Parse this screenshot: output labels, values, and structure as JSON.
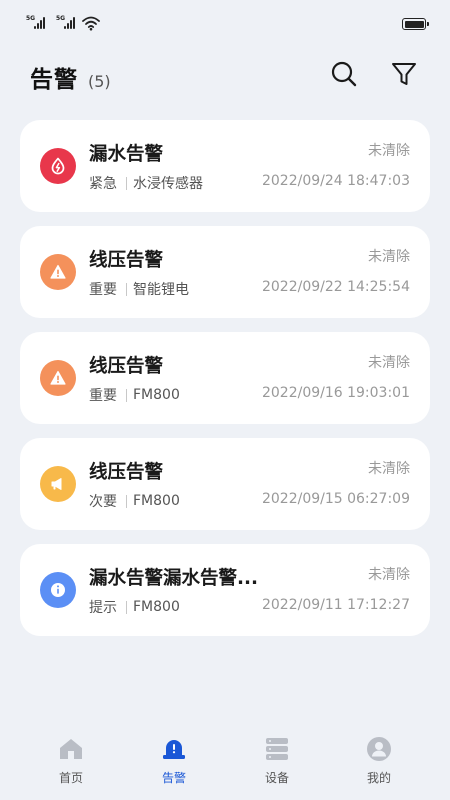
{
  "status_bar": {
    "signal1": "5G",
    "signal2": "5G"
  },
  "header": {
    "title": "告警",
    "count": "(5)"
  },
  "icons": {
    "search": "search-icon",
    "filter": "filter-icon"
  },
  "alarms": [
    {
      "title": "漏水告警",
      "level": "紧急",
      "source": "水浸传感器",
      "status": "未清除",
      "time": "2022/09/24 18:47:03",
      "color": "#e8374b",
      "icon": "water-leak-icon"
    },
    {
      "title": "线压告警",
      "level": "重要",
      "source": "智能锂电",
      "status": "未清除",
      "time": "2022/09/22 14:25:54",
      "color": "#f4915b",
      "icon": "warning-triangle-icon"
    },
    {
      "title": "线压告警",
      "level": "重要",
      "source": "FM800",
      "status": "未清除",
      "time": "2022/09/16 19:03:01",
      "color": "#f4915b",
      "icon": "warning-triangle-icon"
    },
    {
      "title": "线压告警",
      "level": "次要",
      "source": "FM800",
      "status": "未清除",
      "time": "2022/09/15 06:27:09",
      "color": "#f8b94a",
      "icon": "megaphone-icon"
    },
    {
      "title": "漏水告警漏水告警...",
      "level": "提示",
      "source": "FM800",
      "status": "未清除",
      "time": "2022/09/11 17:12:27",
      "color": "#5b8ff5",
      "icon": "info-icon"
    }
  ],
  "nav": {
    "home": "首页",
    "alarm": "告警",
    "device": "设备",
    "mine": "我的",
    "active": "alarm",
    "active_color": "#1a57d6",
    "inactive_color": "#b9bdc5"
  }
}
